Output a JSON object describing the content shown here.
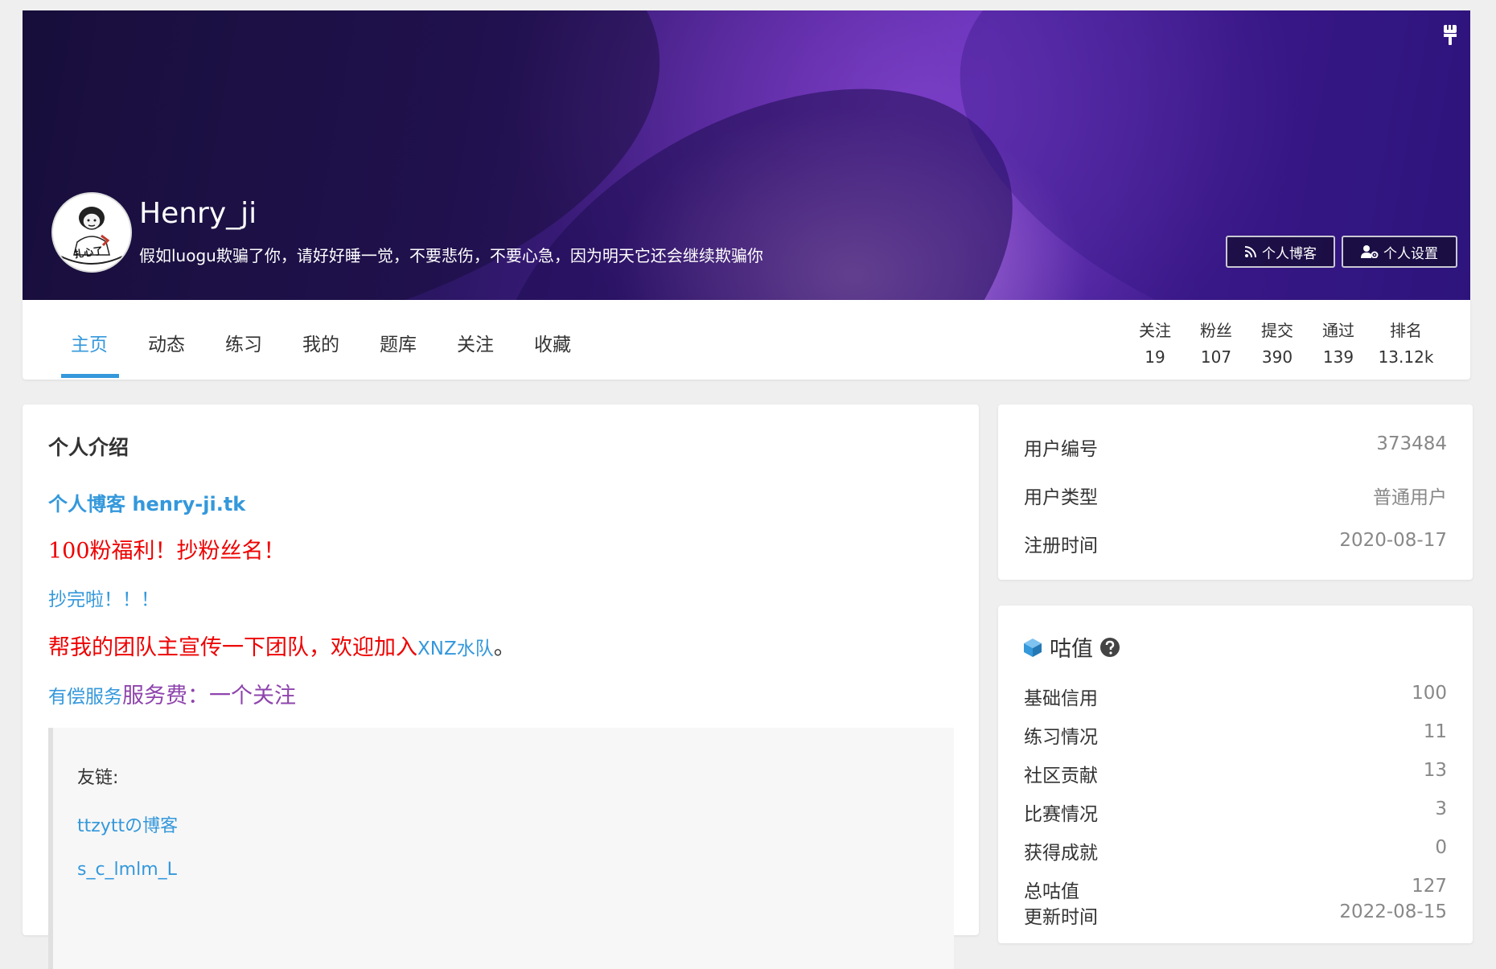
{
  "profile": {
    "username": "Henry_ji",
    "slogan": "假如luogu欺骗了你，请好好睡一觉，不要悲伤，不要心急，因为明天它还会继续欺骗你",
    "avatar_caption": "扎心了"
  },
  "buttons": {
    "blog": "个人博客",
    "settings": "个人设置"
  },
  "tabs": [
    {
      "label": "主页",
      "active": true
    },
    {
      "label": "动态"
    },
    {
      "label": "练习"
    },
    {
      "label": "我的"
    },
    {
      "label": "题库"
    },
    {
      "label": "关注"
    },
    {
      "label": "收藏"
    }
  ],
  "stats": [
    {
      "label": "关注",
      "value": "19"
    },
    {
      "label": "粉丝",
      "value": "107"
    },
    {
      "label": "提交",
      "value": "390"
    },
    {
      "label": "通过",
      "value": "139"
    },
    {
      "label": "排名",
      "value": "13.12k"
    }
  ],
  "intro": {
    "title": "个人介绍",
    "blog_link": "个人博客 henry-ji.tk",
    "line1": "100粉福利！抄粉丝名！",
    "line2": "抄完啦！！！",
    "line3_red": "帮我的团队主宣传一下团队，欢迎加入",
    "line3_link": "XNZ水队",
    "line3_end": "。",
    "line4_link": "有偿服务",
    "line4_text": "服务费：一个关注",
    "quote": {
      "title": "友链:",
      "links": [
        "ttzyttの博客",
        "s_c_lmlm_L"
      ]
    }
  },
  "info": [
    {
      "label": "用户编号",
      "value": "373484"
    },
    {
      "label": "用户类型",
      "value": "普通用户"
    },
    {
      "label": "注册时间",
      "value": "2020-08-17"
    }
  ],
  "score": {
    "title": "咕值",
    "rows": [
      {
        "label": "基础信用",
        "value": "100"
      },
      {
        "label": "练习情况",
        "value": "11"
      },
      {
        "label": "社区贡献",
        "value": "13"
      },
      {
        "label": "比赛情况",
        "value": "3"
      },
      {
        "label": "获得成就",
        "value": "0"
      },
      {
        "label": "总咕值",
        "value": "127"
      },
      {
        "label": "更新时间",
        "value": "2022-08-15"
      }
    ]
  },
  "colors": {
    "accent": "#3498db",
    "red_text": "#e00000",
    "purple_text": "#8e44ad"
  }
}
